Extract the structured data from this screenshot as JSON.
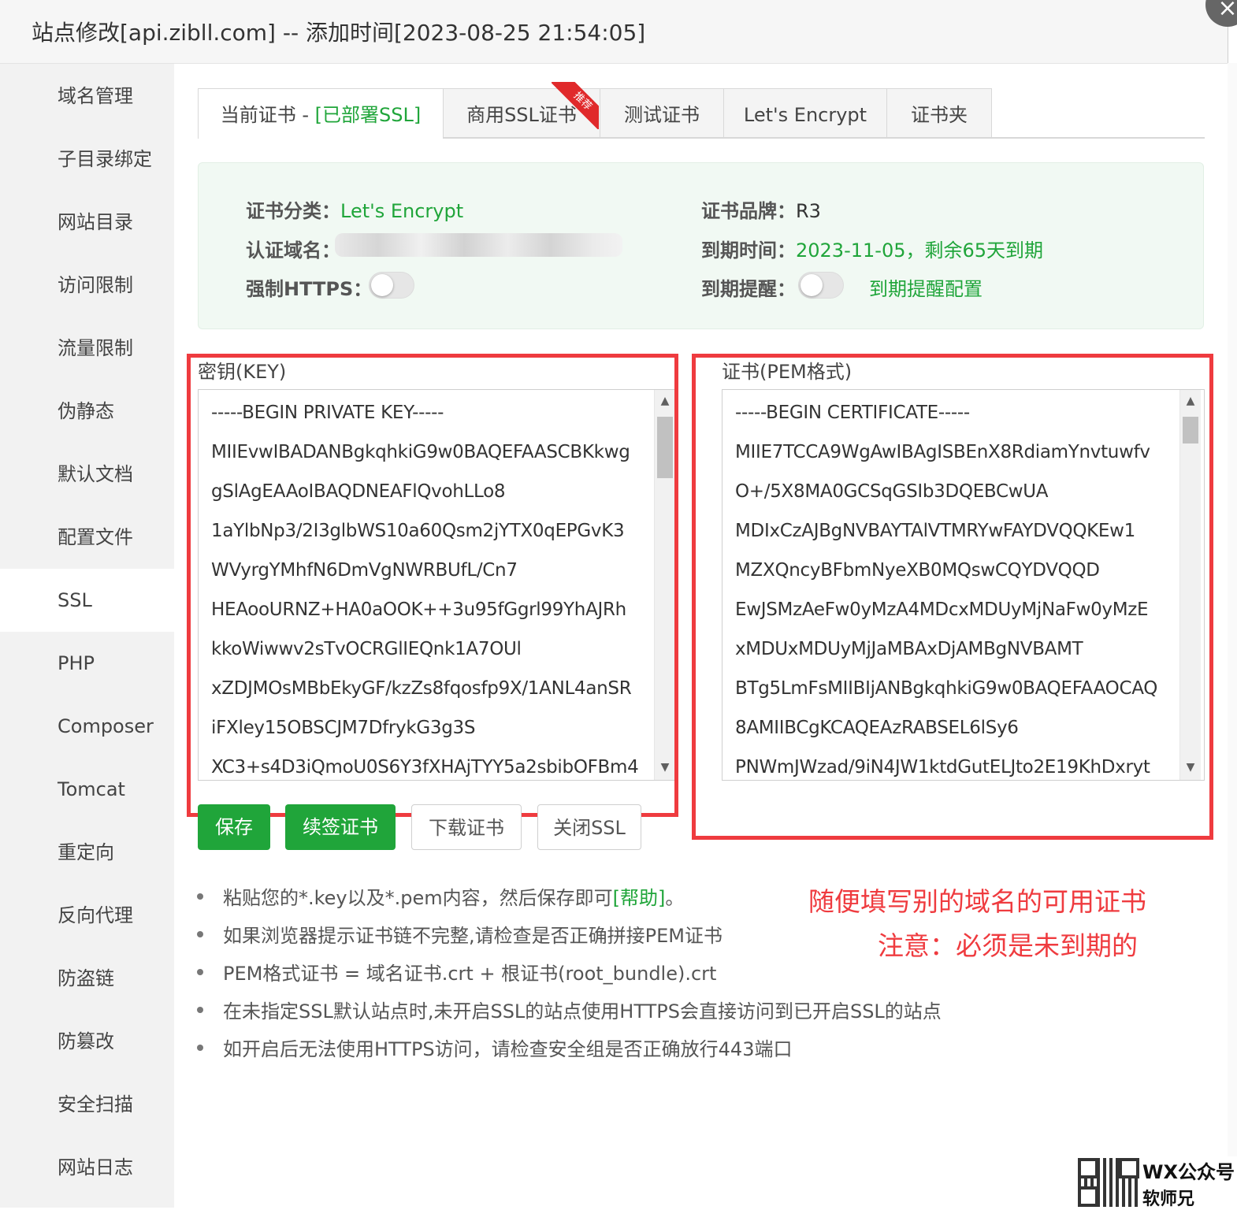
{
  "window": {
    "title": "站点修改[api.zibll.com] -- 添加时间[2023-08-25 21:54:05]",
    "close_glyph": "×"
  },
  "sidebar": {
    "items": [
      {
        "label": "域名管理"
      },
      {
        "label": "子目录绑定"
      },
      {
        "label": "网站目录"
      },
      {
        "label": "访问限制"
      },
      {
        "label": "流量限制"
      },
      {
        "label": "伪静态"
      },
      {
        "label": "默认文档"
      },
      {
        "label": "配置文件"
      },
      {
        "label": "SSL",
        "active": true
      },
      {
        "label": "PHP"
      },
      {
        "label": "Composer"
      },
      {
        "label": "Tomcat"
      },
      {
        "label": "重定向"
      },
      {
        "label": "反向代理"
      },
      {
        "label": "防盗链"
      },
      {
        "label": "防篡改"
      },
      {
        "label": "安全扫描"
      },
      {
        "label": "网站日志"
      }
    ]
  },
  "tabs": {
    "current_prefix": "当前证书 - ",
    "current_status": "[已部署SSL]",
    "commercial": "商用SSL证书",
    "commercial_badge": "推荐",
    "test": "测试证书",
    "letsencrypt": "Let's Encrypt",
    "folder": "证书夹"
  },
  "cert_info": {
    "category_label": "证书分类：",
    "category_value": "Let's Encrypt",
    "brand_label": "证书品牌：",
    "brand_value": "R3",
    "domain_label": "认证域名：",
    "expiry_label": "到期时间：",
    "expiry_value": "2023-11-05，剩余65天到期",
    "force_https_label": "强制HTTPS：",
    "force_https_on": false,
    "remind_label": "到期提醒：",
    "remind_on": false,
    "remind_config_link": "到期提醒配置"
  },
  "key_field": {
    "label": "密钥(KEY)",
    "lines": [
      "-----BEGIN PRIVATE KEY-----",
      "MIIEvwIBADANBgkqhkiG9w0BAQEFAASCBKkwg",
      "gSlAgEAAoIBAQDNEAFlQvohLLo8",
      "1aYlbNp3/2I3glbWS10a60Qsm2jYTX0qEPGvK3",
      "WVyrgYMhfN6DmVgNWRBUfL/Cn7",
      "HEAooURNZ+HA0aOOK++3u95fGgrl99YhAJRh",
      "kkoWiwwv2sTvOCRGlIEQnk1A7OUl",
      "xZDJMOsMBbEkyGF/kzZs8fqosfp9X/1ANL4anSR",
      "iFXley15OBSCJM7DfrykG3g3S",
      "XC3+s4D3iQmoU0S6Y3fXHAjTYY5a2sbibOFBm4"
    ]
  },
  "cert_field": {
    "label": "证书(PEM格式)",
    "lines": [
      "-----BEGIN CERTIFICATE-----",
      "MIIE7TCCA9WgAwIBAgISBEnX8RdiamYnvtuwfv",
      "O+/5X8MA0GCSqGSIb3DQEBCwUA",
      "MDIxCzAJBgNVBAYTAlVTMRYwFAYDVQQKEw1",
      "MZXQncyBFbmNyeXB0MQswCQYDVQQD",
      "EwJSMzAeFw0yMzA4MDcxMDUyMjNaFw0yMzE",
      "xMDUxMDUyMjJaMBAxDjAMBgNVBAMT",
      "BTg5LmFsMIIBIjANBgkqhkiG9w0BAQEFAAOCAQ",
      "8AMIIBCgKCAQEAzRABSEL6lSy6",
      "PNWmJWzad/9iN4JW1ktdGutELJto2E19KhDxryt"
    ]
  },
  "buttons": {
    "save": "保存",
    "renew": "续签证书",
    "download": "下载证书",
    "close_ssl": "关闭SSL"
  },
  "notes": {
    "n1_pre": "粘贴您的*.key以及*.pem内容，然后保存即可",
    "n1_help": "[帮助]",
    "n1_post": "。",
    "n2": "如果浏览器提示证书链不完整,请检查是否正确拼接PEM证书",
    "n3": "PEM格式证书 = 域名证书.crt + 根证书(root_bundle).crt",
    "n4": "在未指定SSL默认站点时,未开启SSL的站点使用HTTPS会直接访问到已开启SSL的站点",
    "n5": "如开启后无法使用HTTPS访问，请检查安全组是否正确放行443端口"
  },
  "annotation": {
    "line1": "随便填写别的域名的可用证书",
    "line2": "注意：必须是未到期的"
  },
  "watermark": {
    "line1": "WX公众号",
    "line2": "软师兄"
  },
  "colors": {
    "accent_green": "#20a53a",
    "annotation_red": "#ef3b3f"
  }
}
